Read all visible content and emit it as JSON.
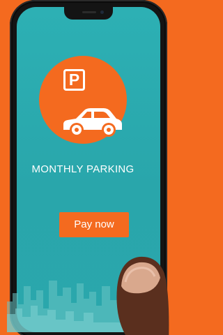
{
  "screen": {
    "title": "MONTHLY PARKING",
    "parking_sign": "P",
    "pay_button_label": "Pay now"
  },
  "icons": [
    "parking-sign-icon",
    "car-icon",
    "city-skyline",
    "finger"
  ],
  "colors": {
    "background": "#f46a1f",
    "screen": "#2db0b4",
    "accent": "#f46a1f",
    "text": "#ffffff",
    "skyline": "#68c4c4"
  }
}
